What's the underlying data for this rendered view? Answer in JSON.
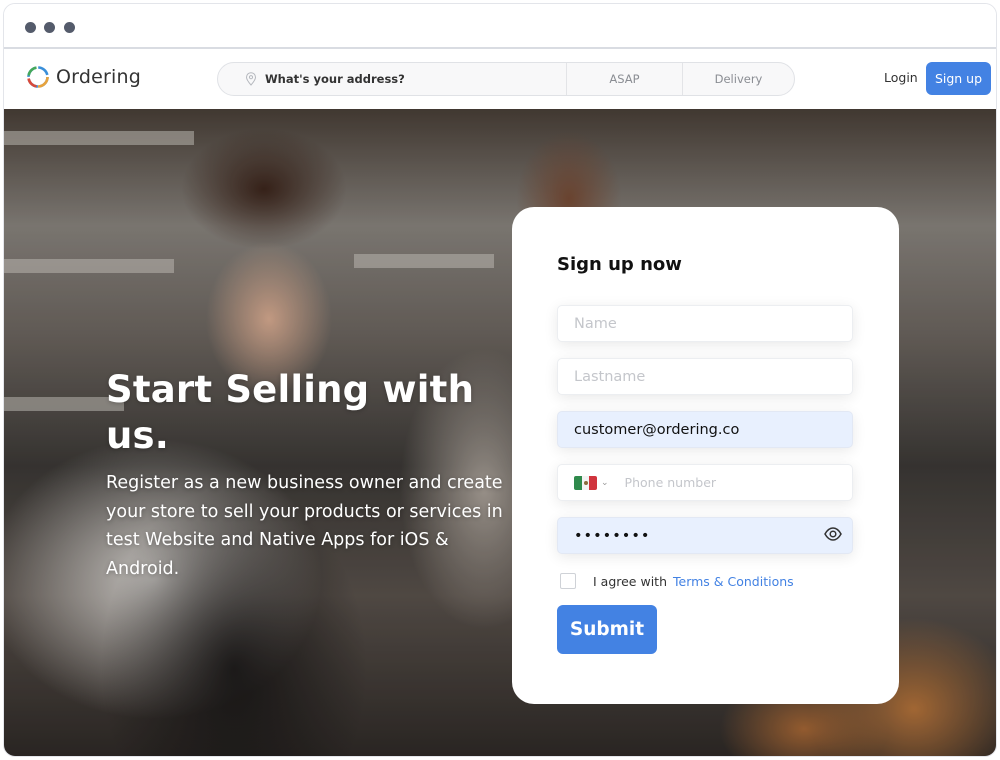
{
  "window": {
    "controls": [
      "dot",
      "dot",
      "dot"
    ]
  },
  "navbar": {
    "brand": "Ordering",
    "logo_colors": [
      "#3a8fd9",
      "#e8a33d",
      "#d94a3a",
      "#45a85a"
    ],
    "address_placeholder": "What's your address?",
    "time_option": "ASAP",
    "order_type": "Delivery",
    "login_label": "Login",
    "signup_label": "Sign up"
  },
  "hero": {
    "title": "Start Selling with us.",
    "description": "Register as a new business owner and create your store to sell your products or services in test Website and Native Apps for iOS & Android."
  },
  "form": {
    "title": "Sign up now",
    "name_placeholder": "Name",
    "lastname_placeholder": "Lastname",
    "email_value": "customer@ordering.co",
    "phone_country": "MX",
    "phone_placeholder": "Phone number",
    "password_value": "••••••••",
    "agree_text": "I agree with",
    "terms_label": "Terms & Conditions",
    "terms_checked": false,
    "submit_label": "Submit"
  },
  "colors": {
    "accent": "#4382e3",
    "autofill_bg": "#e8f0fe"
  }
}
